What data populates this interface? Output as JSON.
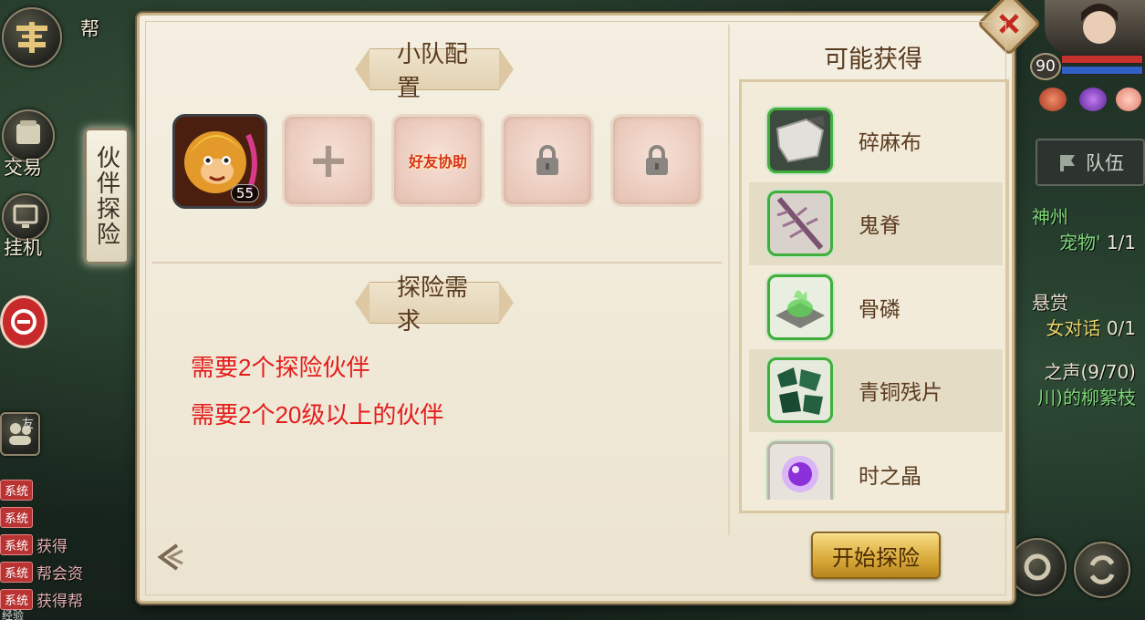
{
  "left_side": {
    "guild_label": "帮",
    "trade_label": "交易",
    "idle_label": "挂机",
    "friend_label": "友",
    "banner_title": "伙伴探险",
    "exp_label": "经验",
    "chat": [
      {
        "tag": "系统",
        "text": ""
      },
      {
        "tag": "系统",
        "text": ""
      },
      {
        "tag": "系统",
        "text": "获得"
      },
      {
        "tag": "系统",
        "text": "帮会资"
      },
      {
        "tag": "系统",
        "text": "获得帮"
      }
    ]
  },
  "right_side": {
    "player_level": "90",
    "team_button": "队伍",
    "tasks": [
      {
        "title": "神州",
        "sub": "宠物'",
        "count": "1/1"
      },
      {
        "title": "悬赏",
        "sub": "女对话",
        "count": "0/1"
      },
      {
        "title": "之声(9/70)",
        "sub": "川)的柳絮枝",
        "count": ""
      }
    ]
  },
  "dialog": {
    "team_section_title": "小队配置",
    "requirement_section_title": "探险需求",
    "hero": {
      "level": "55"
    },
    "slots": [
      {
        "type": "add",
        "label": "+"
      },
      {
        "type": "friend",
        "label": "好友协助"
      },
      {
        "type": "locked",
        "label": ""
      },
      {
        "type": "locked",
        "label": ""
      }
    ],
    "requirements": [
      "需要2个探险伙伴",
      "需要2个20级以上的伙伴"
    ],
    "loot_title": "可能获得",
    "loot": [
      {
        "name": "碎麻布",
        "icon": "cloth-icon"
      },
      {
        "name": "鬼脊",
        "icon": "spine-icon"
      },
      {
        "name": "骨磷",
        "icon": "bone-phosphor-icon"
      },
      {
        "name": "青铜残片",
        "icon": "bronze-shard-icon"
      },
      {
        "name": "时之晶",
        "icon": "time-crystal-icon"
      }
    ],
    "start_button": "开始探险"
  }
}
